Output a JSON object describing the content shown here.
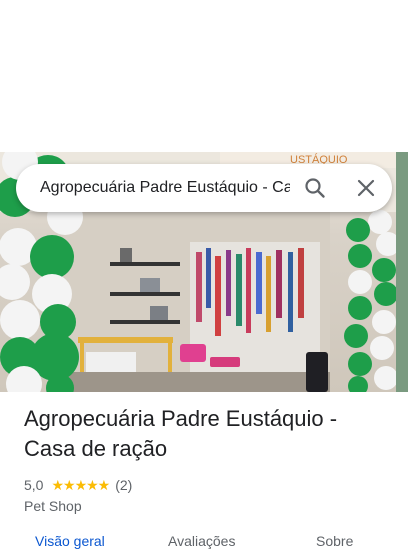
{
  "search": {
    "query": "Agropecuária Padre Eustáquio - Casa de ração"
  },
  "place": {
    "name": "Agropecuária Padre Eustáquio - Casa de ração",
    "rating": "5,0",
    "stars": "★★★★★",
    "review_count": "(2)",
    "category": "Pet Shop"
  },
  "tabs": [
    {
      "label": "Visão geral"
    },
    {
      "label": "Avaliações"
    },
    {
      "label": "Sobre"
    }
  ],
  "colors": {
    "accent": "#0b57d0",
    "star": "#fbbc04",
    "balloon_green": "#1e9e4a",
    "balloon_white": "#f4f4f4"
  },
  "icons": {
    "search": "search-icon",
    "close": "close-icon"
  }
}
